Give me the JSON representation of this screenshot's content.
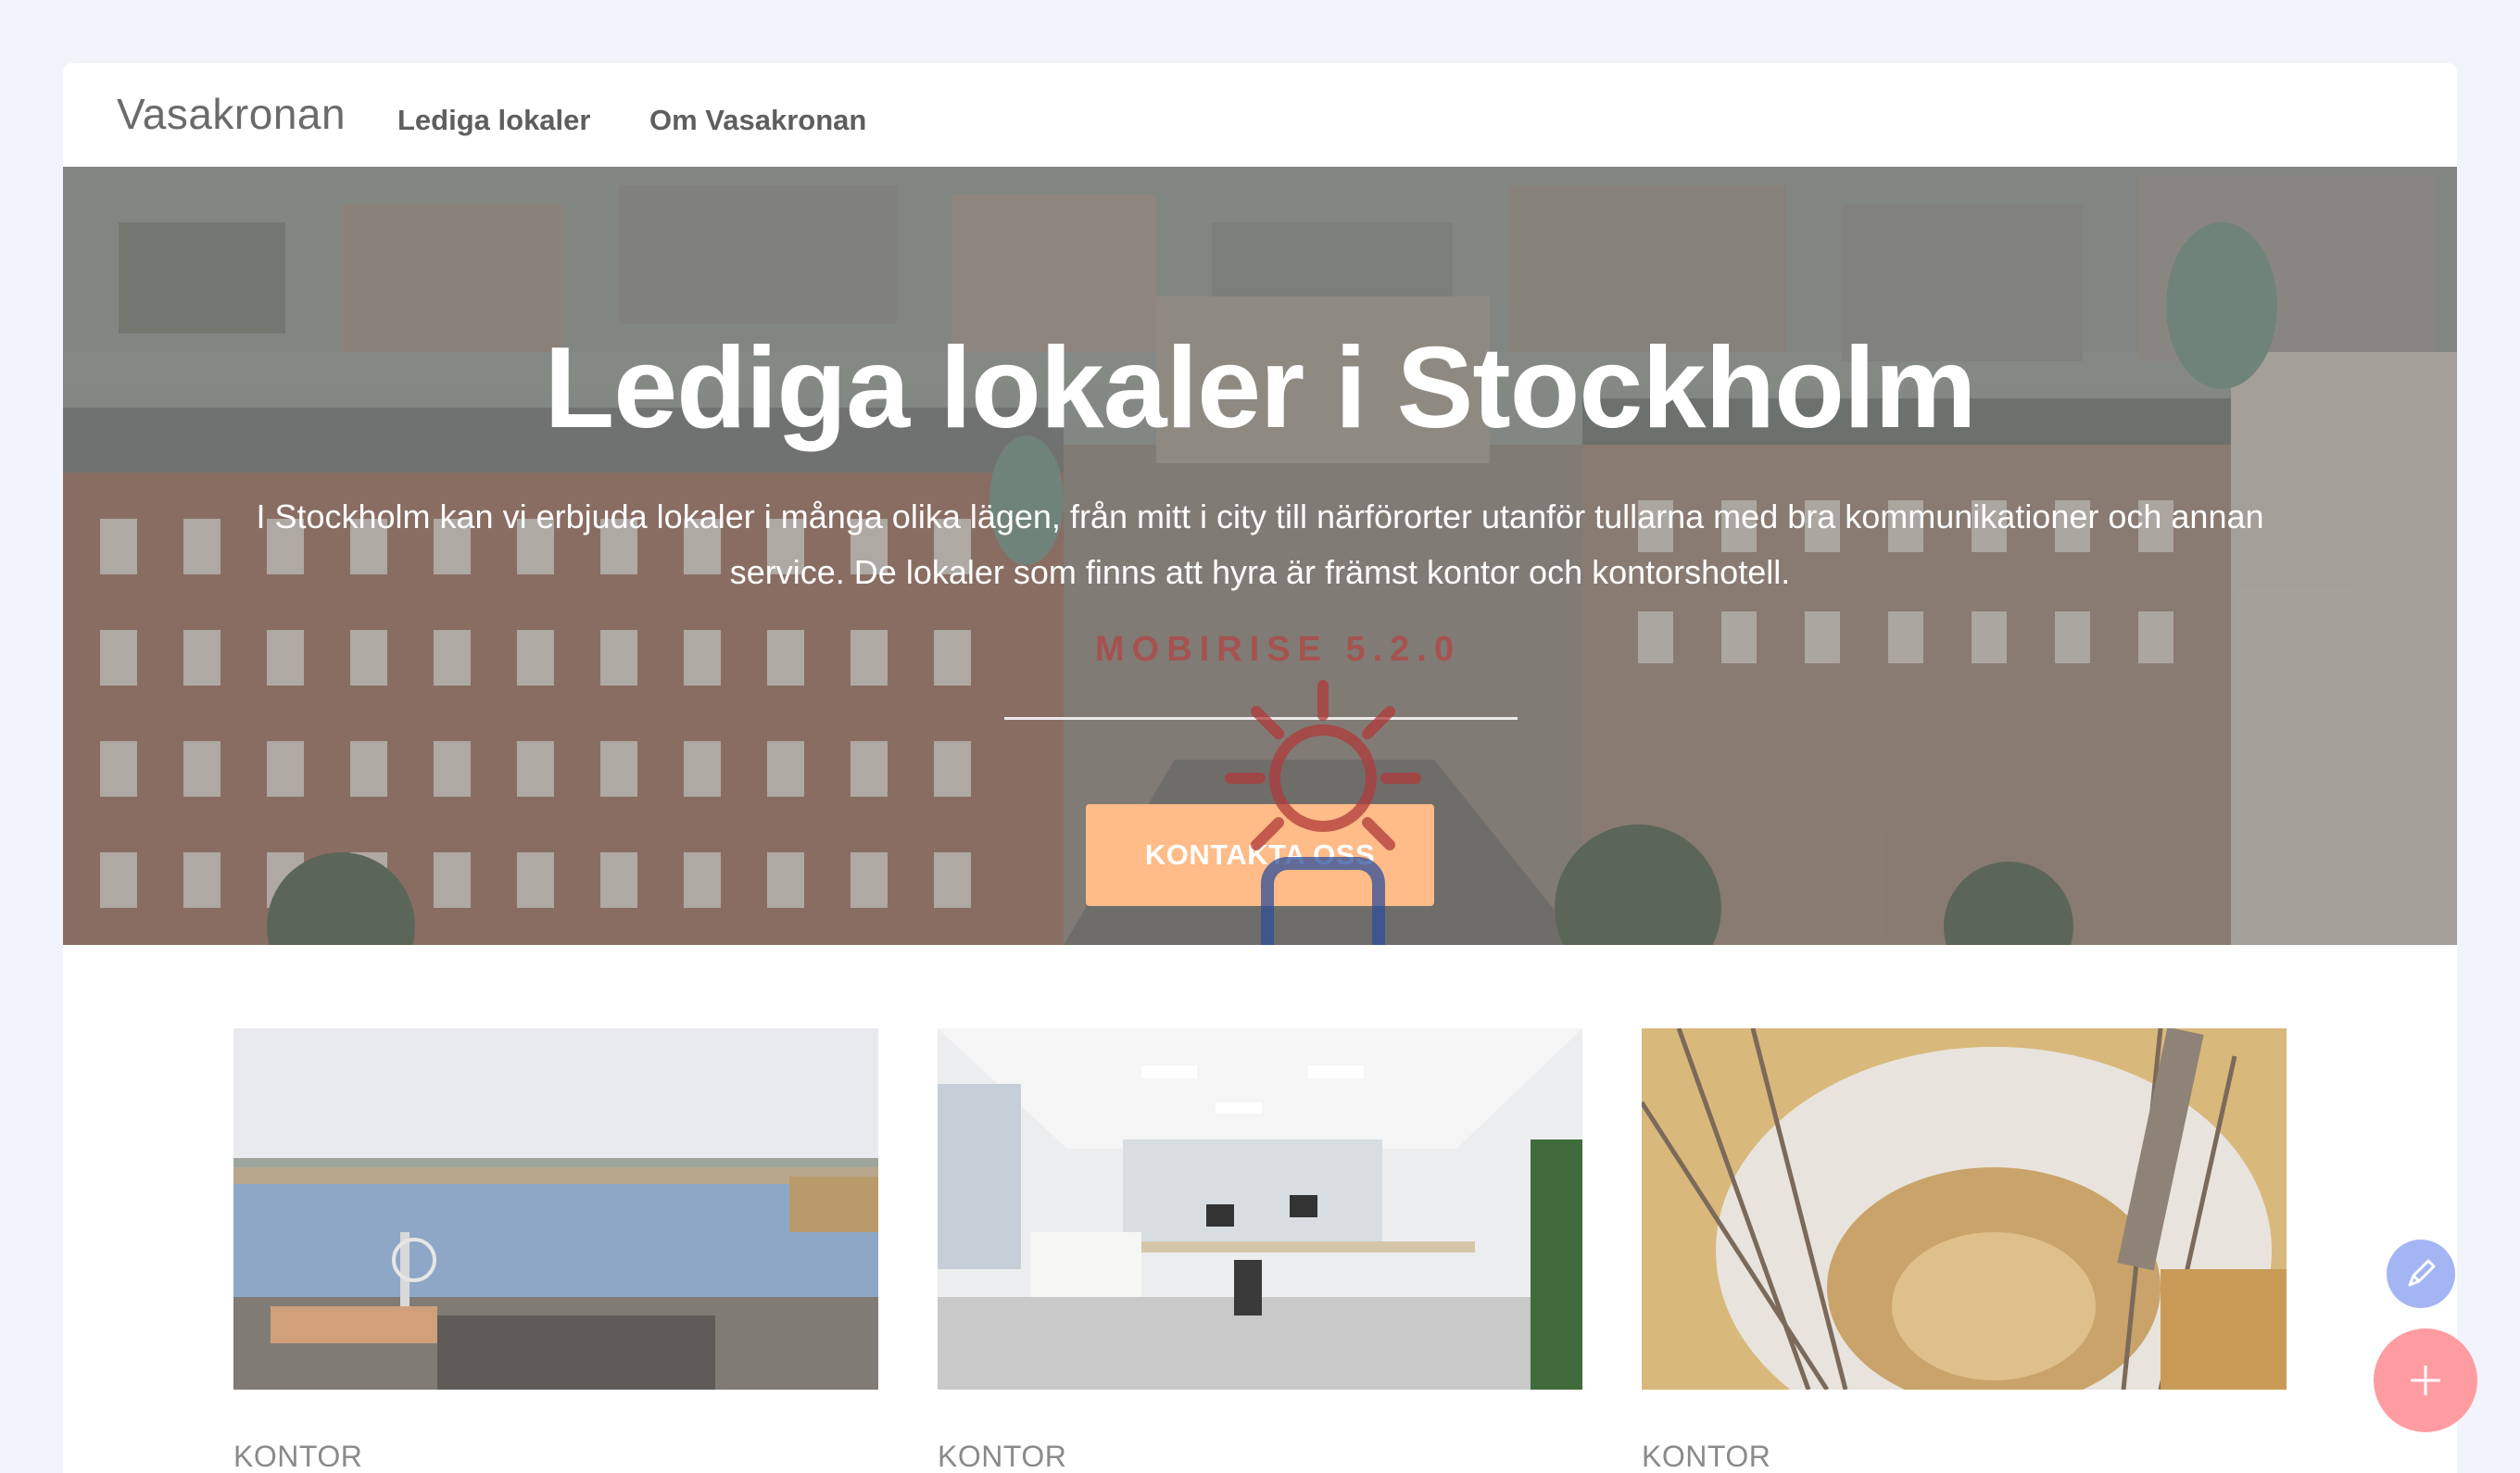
{
  "navbar": {
    "brand": "Vasakronan",
    "links": [
      {
        "label": "Lediga lokaler"
      },
      {
        "label": "Om Vasakronan"
      }
    ]
  },
  "hero": {
    "title": "Lediga lokaler i Stockholm",
    "description": "I Stockholm kan vi erbjuda lokaler i många olika lägen, från mitt i city till närförorter utanför tullarna med bra kommunikationer och annan service. De lokaler som finns att hyra är främst kontor och kontorshotell.",
    "cta_label": "KONTAKTA OSS",
    "watermark_text": "MOBIRISE 5.2.0"
  },
  "cards": [
    {
      "category": "KONTOR",
      "image_icon": "waterfront-city-photo"
    },
    {
      "category": "KONTOR",
      "image_icon": "office-interior-photo"
    },
    {
      "category": "KONTOR",
      "image_icon": "spiral-staircase-photo"
    }
  ],
  "floating_buttons": {
    "edit_icon": "pencil-icon",
    "add_icon": "plus-icon"
  },
  "colors": {
    "page_background": "#f1f4fb",
    "cta": "#ffbb88",
    "fab_edit": "#a4b5f4",
    "fab_add": "#ff9ca2"
  }
}
